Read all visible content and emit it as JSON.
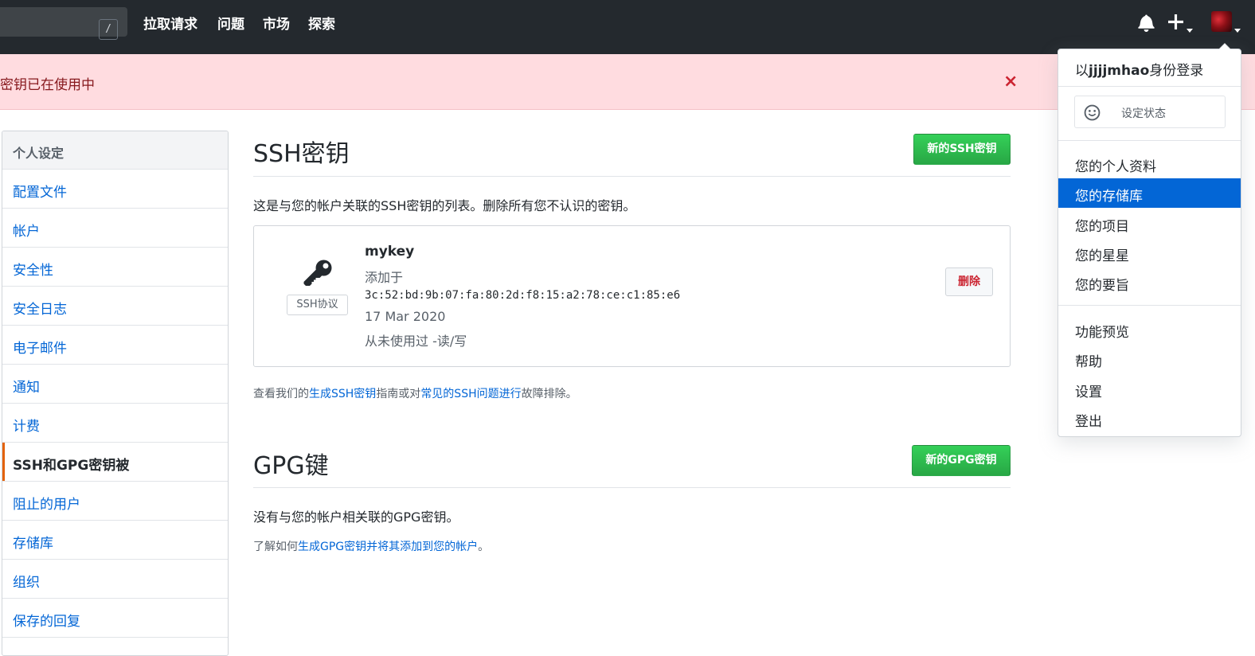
{
  "header": {
    "search_hint": "/",
    "nav": [
      "拉取请求",
      "问题",
      "市场",
      "探索"
    ],
    "icons": [
      "bell-icon",
      "plus-icon",
      "avatar"
    ]
  },
  "flash": {
    "message": "密钥已在使用中",
    "close": "×"
  },
  "sidebar": {
    "heading": "个人设定",
    "items": [
      "配置文件",
      "帐户",
      "安全性",
      "安全日志",
      "电子邮件",
      "通知",
      "计费",
      "SSH和GPG密钥被",
      "阻止的用户",
      "存储库",
      "组织",
      "保存的回复"
    ],
    "active_index": 7
  },
  "ssh": {
    "title": "SSH密钥",
    "new_button": "新的SSH密钥",
    "description": "这是与您的帐户关联的SSH密钥的列表。删除所有您不认识的密钥。",
    "key": {
      "protocol": "SSH协议",
      "name": "mykey",
      "added_label": "添加于",
      "fingerprint": "3c:52:bd:9b:07:fa:80:2d:f8:15:a2:78:ce:c1:85:e6",
      "date": "17 Mar 2020",
      "usage": "从未使用过 -读/写",
      "delete_button": "删除"
    },
    "help": {
      "prefix": "查看我们的",
      "link1": "生成SSH密钥",
      "middle": "指南或对",
      "link2": "常见的SSH问题进行",
      "suffix": "故障排除。"
    }
  },
  "gpg": {
    "title": "GPG键",
    "new_button": "新的GPG密钥",
    "description": "没有与您的帐户相关联的GPG密钥。",
    "help": {
      "prefix": "了解如何",
      "link": "生成GPG密钥并将其添加到您的帐户",
      "suffix": "。"
    }
  },
  "user_menu": {
    "signed_in_prefix": "以",
    "username": "jjjjmhao",
    "signed_in_suffix": "身份登录",
    "set_status": "设定状态",
    "items_group1": [
      "您的个人资料",
      "您的存储库",
      "您的项目",
      "您的星星",
      "您的要旨"
    ],
    "highlighted": "您的存储库",
    "items_group2": [
      "功能预览",
      "帮助",
      "设置",
      "登出"
    ]
  },
  "colors": {
    "header_bg": "#24292e",
    "flash_bg": "#ffdce0",
    "green": "#28a745",
    "link": "#0366d6",
    "active_bar": "#e36209"
  }
}
